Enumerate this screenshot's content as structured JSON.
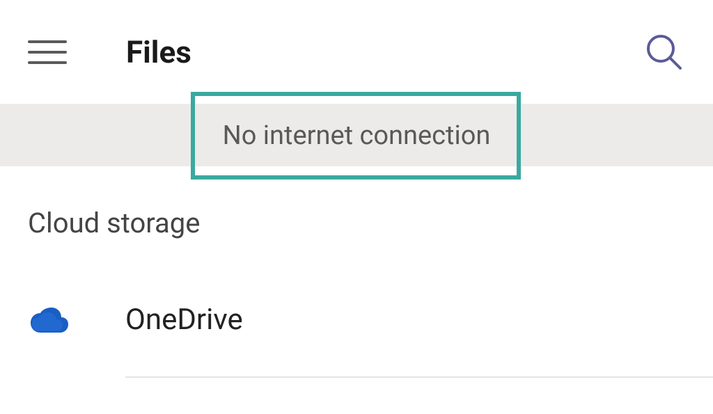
{
  "header": {
    "title": "Files"
  },
  "banner": {
    "message": "No internet connection"
  },
  "section": {
    "heading": "Cloud storage"
  },
  "storage_items": [
    {
      "label": "OneDrive",
      "icon": "onedrive"
    }
  ],
  "colors": {
    "highlight": "#3aa99f",
    "onedrive": "#1a5ec4",
    "search": "#5b5b98"
  }
}
